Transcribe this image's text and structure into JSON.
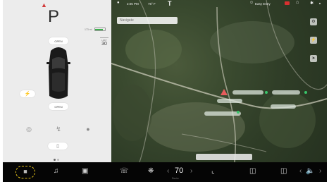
{
  "status": {
    "time": "2:05 PM",
    "temperature": "75° F",
    "profile": "Easy Entry"
  },
  "car": {
    "gear": "P",
    "battery_text": "173 mi",
    "battery_level": 0.85,
    "speed_limit_label": "LIMIT",
    "speed_limit": "30",
    "frunk_label": "OPEN",
    "trunk_label": "OPEN"
  },
  "map": {
    "search_placeholder": "Navigate"
  },
  "dock": {
    "temperature": "70",
    "temperature_caption": "Recirc"
  },
  "icons": {
    "seatbelt": "seatbelt-warning-icon",
    "lock": "lock-icon",
    "tesla": "tesla-logo-icon",
    "car": "car-icon",
    "music": "music-note-icon",
    "apps": "app-launcher-icon",
    "phone": "phone-icon",
    "fan": "fan-icon",
    "seat": "seat-heater-icon",
    "defrost_front": "front-defrost-icon",
    "defrost_rear": "rear-defrost-icon",
    "volume": "volume-icon"
  },
  "colors": {
    "accent_yellow": "#e5c21a",
    "battery_green": "#3fb04f",
    "alert_red": "#d23b3b"
  }
}
